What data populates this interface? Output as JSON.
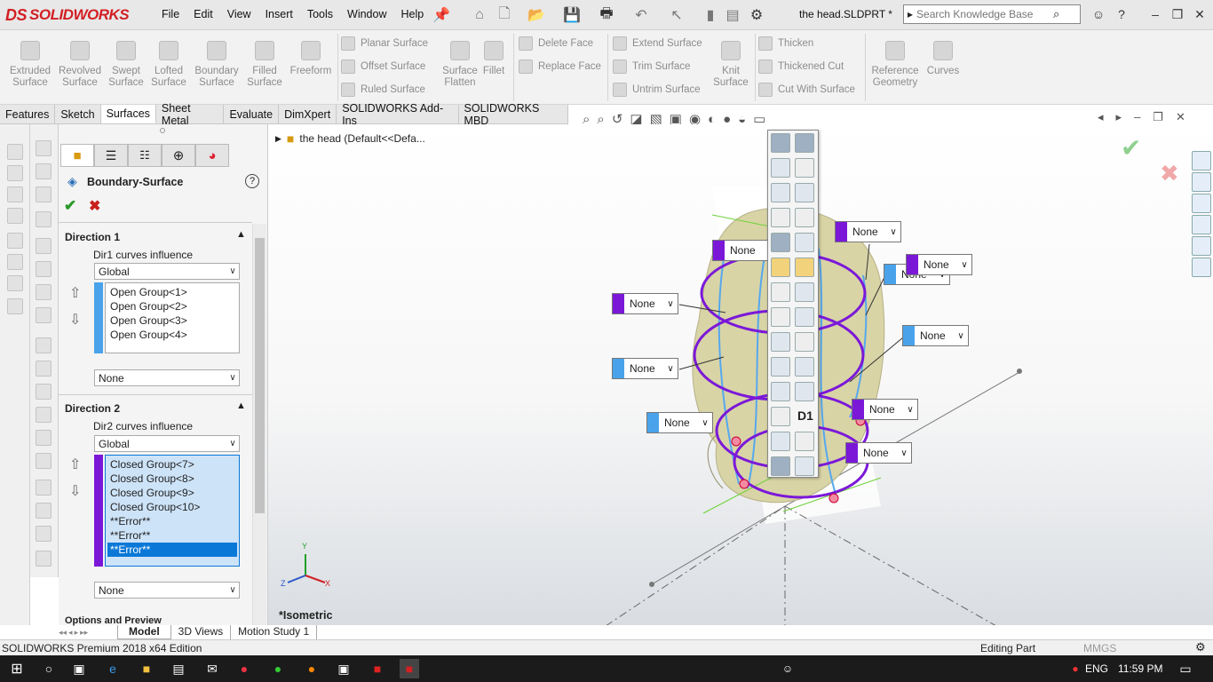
{
  "app": {
    "logo_text": "SOLIDWORKS",
    "logo_mark": "DS",
    "document_title": "the head.SLDPRT *"
  },
  "menu": [
    "File",
    "Edit",
    "View",
    "Insert",
    "Tools",
    "Window",
    "Help"
  ],
  "search": {
    "placeholder": "Search Knowledge Base"
  },
  "ribbon": {
    "large_buttons": [
      {
        "label": "Extruded Surface",
        "icon": "extruded-surface-icon"
      },
      {
        "label": "Revolved Surface",
        "icon": "revolved-surface-icon"
      },
      {
        "label": "Swept Surface",
        "icon": "swept-surface-icon"
      },
      {
        "label": "Lofted Surface",
        "icon": "lofted-surface-icon"
      },
      {
        "label": "Boundary Surface",
        "icon": "boundary-surface-icon"
      },
      {
        "label": "Filled Surface",
        "icon": "filled-surface-icon"
      },
      {
        "label": "Freeform",
        "icon": "freeform-icon"
      }
    ],
    "group1": [
      "Planar Surface",
      "Offset Surface",
      "Ruled Surface"
    ],
    "surface_flatten": "Surface Flatten",
    "fillet": "Fillet",
    "group2": [
      "Delete Face",
      "Replace Face"
    ],
    "group3": [
      "Extend Surface",
      "Trim Surface",
      "Untrim Surface"
    ],
    "knit_surface": "Knit Surface",
    "group4": [
      "Thicken",
      "Thickened Cut",
      "Cut With Surface"
    ],
    "reference_geometry": "Reference Geometry",
    "curves": "Curves"
  },
  "tabs": [
    "Features",
    "Sketch",
    "Surfaces",
    "Sheet Metal",
    "Evaluate",
    "DimXpert",
    "SOLIDWORKS Add-Ins",
    "SOLIDWORKS MBD"
  ],
  "active_tab": "Surfaces",
  "property_manager": {
    "title": "Boundary-Surface",
    "direction1": {
      "header": "Direction 1",
      "influence_label": "Dir1 curves influence",
      "influence_value": "Global",
      "curves": [
        "Open Group<1>",
        "Open Group<2>",
        "Open Group<3>",
        "Open Group<4>"
      ],
      "tangency": "None"
    },
    "direction2": {
      "header": "Direction 2",
      "influence_label": "Dir2 curves influence",
      "influence_value": "Global",
      "curves": [
        "Closed Group<7>",
        "Closed Group<8>",
        "Closed Group<9>",
        "Closed Group<10>",
        "**Error**",
        "**Error**",
        "**Error**"
      ],
      "tangency": "None"
    },
    "options_header": "Options and Preview"
  },
  "tree": {
    "root": "the head  (Default<<Defa..."
  },
  "viewport": {
    "view_label": "*Isometric",
    "axis_labels": {
      "x": "X",
      "y": "Y",
      "z": "Z"
    },
    "callouts": [
      "None",
      "None",
      "None",
      "None",
      "None",
      "None",
      "None",
      "None",
      "None",
      "None",
      "None",
      "None"
    ],
    "d1_label": "D1"
  },
  "bottom_tabs": [
    "Model",
    "3D Views",
    "Motion Study 1"
  ],
  "status": {
    "edition": "SOLIDWORKS Premium 2018 x64 Edition",
    "mode": "Editing Part",
    "units": "MMGS"
  },
  "taskbar": {
    "language": "ENG",
    "time": "11:59 PM"
  },
  "colors": {
    "accent_red": "#d21f24",
    "direction2_purple": "#7b18d8",
    "direction1_blue": "#4aa3ea",
    "selection": "#0a78d7"
  }
}
